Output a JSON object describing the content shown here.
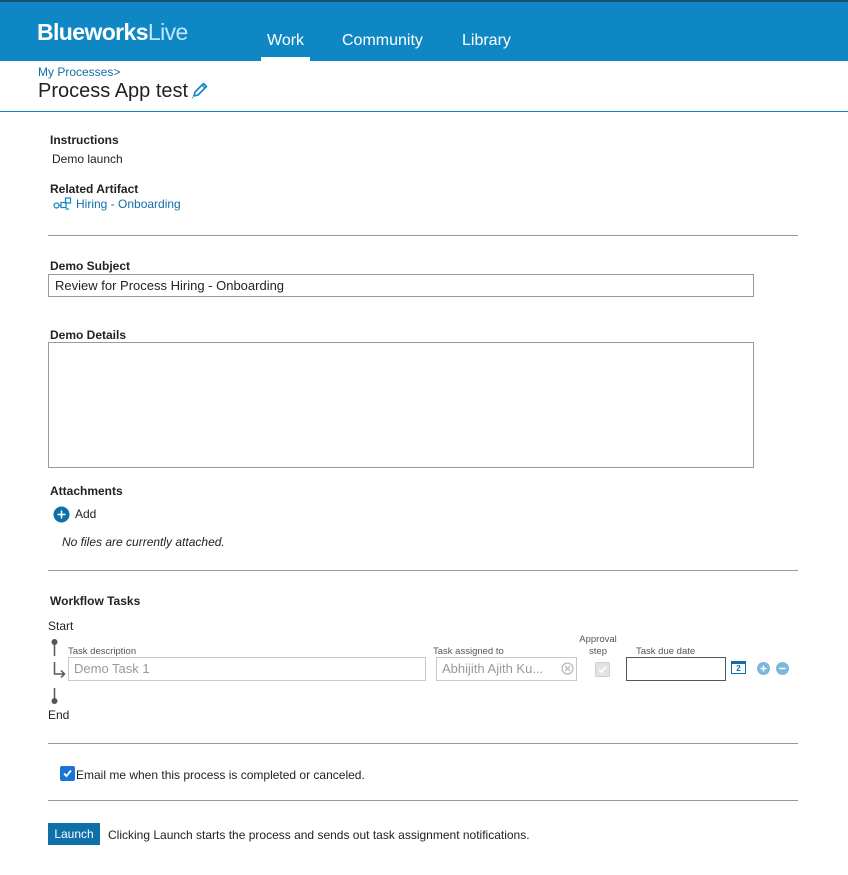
{
  "app": {
    "logo_bold": "Blueworks",
    "logo_light": "Live"
  },
  "nav": {
    "work": "Work",
    "community": "Community",
    "library": "Library"
  },
  "breadcrumb": "My Processes>",
  "page_title": "Process App test",
  "instructions": {
    "label": "Instructions",
    "value": "Demo launch"
  },
  "artifact": {
    "label": "Related Artifact",
    "link": "Hiring - Onboarding"
  },
  "subject": {
    "label": "Demo Subject",
    "value": "Review for Process Hiring - Onboarding"
  },
  "details": {
    "label": "Demo Details",
    "value": ""
  },
  "attachments": {
    "label": "Attachments",
    "add_label": "Add",
    "empty": "No files are currently attached."
  },
  "workflow": {
    "label": "Workflow Tasks",
    "start": "Start",
    "end": "End",
    "col_desc": "Task description",
    "col_assigned": "Task assigned to",
    "col_approval": "Approval step",
    "col_due": "Task due date",
    "task": {
      "description": "Demo Task 1",
      "assigned": "Abhijith Ajith Ku...",
      "due_date": "",
      "calendar_day": "2"
    }
  },
  "email_option": {
    "label": "Email me when this process is completed or canceled.",
    "checked": true
  },
  "launch": {
    "button": "Launch",
    "note": "Clicking Launch starts the process and sends out task assignment notifications."
  },
  "colors": {
    "brand": "#0f87c4",
    "link": "#0f6fa8",
    "header_border": "#1b4f72"
  }
}
